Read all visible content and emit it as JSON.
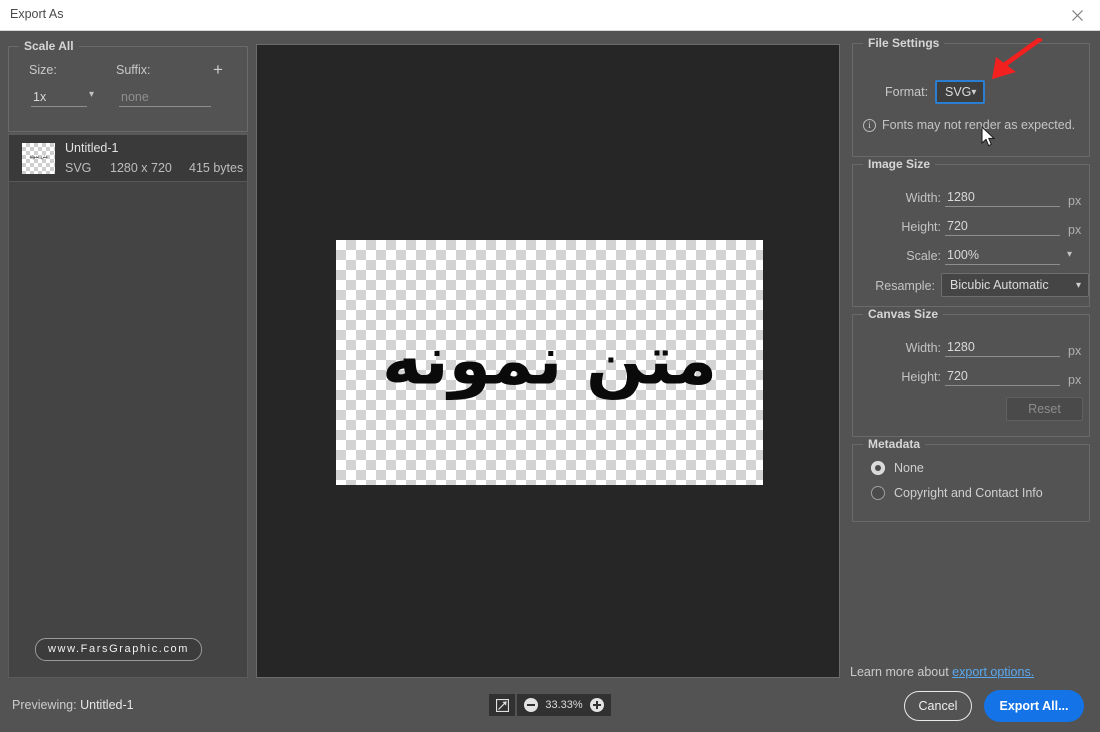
{
  "window": {
    "title": "Export As",
    "close_icon": "close-icon"
  },
  "scale_all": {
    "legend": "Scale All",
    "size_label": "Size:",
    "size_value": "1x",
    "suffix_label": "Suffix:",
    "suffix_placeholder": "none",
    "add_label": "+"
  },
  "file_list": {
    "items": [
      {
        "name": "Untitled-1",
        "format": "SVG",
        "dimensions": "1280 x 720",
        "size": "415 bytes",
        "thumb_text": "متن نمونه"
      }
    ]
  },
  "watermark": {
    "text": "www.FarsGraphic.com"
  },
  "preview": {
    "artboard_text": "متن نمونه"
  },
  "file_settings": {
    "legend": "File Settings",
    "format_label": "Format:",
    "format_value": "SVG",
    "note_icon": "info-icon",
    "note_text": "Fonts may not render as expected."
  },
  "image_size": {
    "legend": "Image Size",
    "width_label": "Width:",
    "width_value": "1280",
    "width_unit": "px",
    "height_label": "Height:",
    "height_value": "720",
    "height_unit": "px",
    "scale_label": "Scale:",
    "scale_value": "100%",
    "resample_label": "Resample:",
    "resample_value": "Bicubic Automatic"
  },
  "canvas_size": {
    "legend": "Canvas Size",
    "width_label": "Width:",
    "width_value": "1280",
    "width_unit": "px",
    "height_label": "Height:",
    "height_value": "720",
    "height_unit": "px",
    "reset_label": "Reset"
  },
  "metadata": {
    "legend": "Metadata",
    "options": [
      {
        "label": "None",
        "selected": true
      },
      {
        "label": "Copyright and Contact Info",
        "selected": false
      }
    ]
  },
  "learn_more": {
    "prefix": "Learn more about",
    "link_text": "export options."
  },
  "status": {
    "prefix": "Previewing:",
    "file": "Untitled-1"
  },
  "zoom_controls": {
    "fit_icon": "fit-to-screen-icon",
    "zoom_out_icon": "zoom-out-icon",
    "zoom_in_icon": "zoom-in-icon",
    "level": "33.33%"
  },
  "footer": {
    "cancel_label": "Cancel",
    "export_label": "Export All..."
  },
  "colors": {
    "accent_blue": "#1473e6",
    "focus_blue": "#2a7fd4",
    "link_blue": "#5aa9f0",
    "annotation_red": "#f2201f",
    "panel_bg": "#535353",
    "canvas_bg": "#262626"
  }
}
